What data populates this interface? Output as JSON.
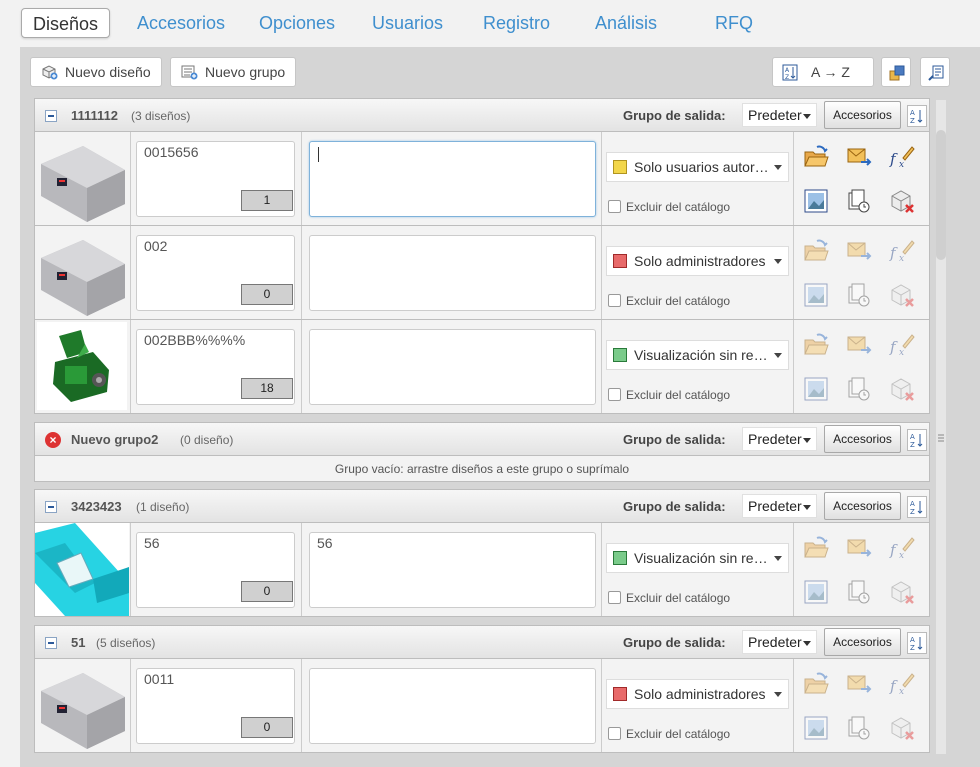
{
  "nav": {
    "tabs": [
      {
        "label": "Diseños"
      },
      {
        "label": "Accesorios"
      },
      {
        "label": "Opciones"
      },
      {
        "label": "Usuarios"
      },
      {
        "label": "Registro"
      },
      {
        "label": "Análisis"
      },
      {
        "label": "RFQ"
      }
    ]
  },
  "toolbar": {
    "new_design": "Nuevo diseño",
    "new_group": "Nuevo grupo",
    "sort_label": "A → Z"
  },
  "common": {
    "output_group_label": "Grupo de salida:",
    "output_group_value": "Predeter",
    "accessories_button": "Accesorios",
    "exclude_catalog": "Excluir del catálogo",
    "empty_group_msg": "Grupo vacío: arrastre diseños a este grupo o suprímalo"
  },
  "groups": [
    {
      "name": "1111112",
      "count": "(3 diseños)",
      "rows": [
        {
          "code": "0015656",
          "qty": "1",
          "description": "",
          "access": "Solo usuarios autor…",
          "thumb": "box"
        },
        {
          "code": "002",
          "qty": "0",
          "description": "",
          "access": "Solo administradores",
          "thumb": "box"
        },
        {
          "code": "002BBB%%%%",
          "qty": "18",
          "description": "",
          "access": "Visualización sin re…",
          "thumb": "machine"
        }
      ]
    },
    {
      "name": "Nuevo grupo2",
      "count": "(0 diseño)",
      "rows": []
    },
    {
      "name": "3423423",
      "count": "(1 diseño)",
      "rows": [
        {
          "code": "56",
          "qty": "0",
          "description": "56",
          "access": "Visualización sin re…",
          "thumb": "cyan"
        }
      ]
    },
    {
      "name": "51",
      "count": "(5 diseños)",
      "rows": [
        {
          "code": "0011",
          "qty": "0",
          "description": "",
          "access": "Solo administradores",
          "thumb": "box"
        }
      ]
    }
  ],
  "colors": {
    "link": "#3f8fce",
    "access_yellow": "#e6c200",
    "access_red": "#d64545",
    "access_green": "#3aa35a"
  }
}
